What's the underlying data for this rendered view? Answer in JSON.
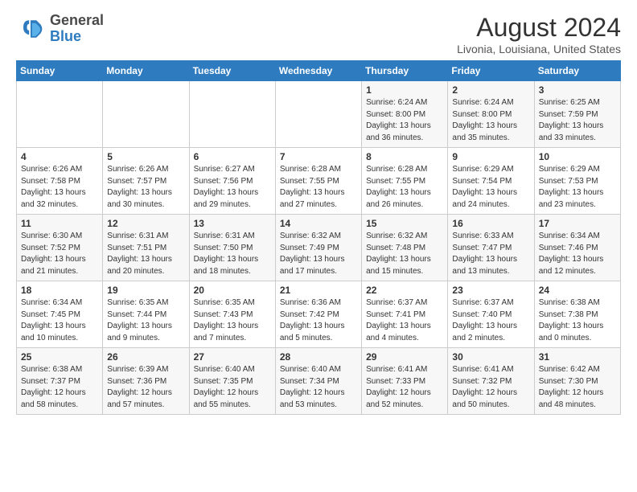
{
  "header": {
    "logo_general": "General",
    "logo_blue": "Blue",
    "month_title": "August 2024",
    "subtitle": "Livonia, Louisiana, United States"
  },
  "weekdays": [
    "Sunday",
    "Monday",
    "Tuesday",
    "Wednesday",
    "Thursday",
    "Friday",
    "Saturday"
  ],
  "weeks": [
    [
      {
        "day": "",
        "content": ""
      },
      {
        "day": "",
        "content": ""
      },
      {
        "day": "",
        "content": ""
      },
      {
        "day": "",
        "content": ""
      },
      {
        "day": "1",
        "content": "Sunrise: 6:24 AM\nSunset: 8:00 PM\nDaylight: 13 hours\nand 36 minutes."
      },
      {
        "day": "2",
        "content": "Sunrise: 6:24 AM\nSunset: 8:00 PM\nDaylight: 13 hours\nand 35 minutes."
      },
      {
        "day": "3",
        "content": "Sunrise: 6:25 AM\nSunset: 7:59 PM\nDaylight: 13 hours\nand 33 minutes."
      }
    ],
    [
      {
        "day": "4",
        "content": "Sunrise: 6:26 AM\nSunset: 7:58 PM\nDaylight: 13 hours\nand 32 minutes."
      },
      {
        "day": "5",
        "content": "Sunrise: 6:26 AM\nSunset: 7:57 PM\nDaylight: 13 hours\nand 30 minutes."
      },
      {
        "day": "6",
        "content": "Sunrise: 6:27 AM\nSunset: 7:56 PM\nDaylight: 13 hours\nand 29 minutes."
      },
      {
        "day": "7",
        "content": "Sunrise: 6:28 AM\nSunset: 7:55 PM\nDaylight: 13 hours\nand 27 minutes."
      },
      {
        "day": "8",
        "content": "Sunrise: 6:28 AM\nSunset: 7:55 PM\nDaylight: 13 hours\nand 26 minutes."
      },
      {
        "day": "9",
        "content": "Sunrise: 6:29 AM\nSunset: 7:54 PM\nDaylight: 13 hours\nand 24 minutes."
      },
      {
        "day": "10",
        "content": "Sunrise: 6:29 AM\nSunset: 7:53 PM\nDaylight: 13 hours\nand 23 minutes."
      }
    ],
    [
      {
        "day": "11",
        "content": "Sunrise: 6:30 AM\nSunset: 7:52 PM\nDaylight: 13 hours\nand 21 minutes."
      },
      {
        "day": "12",
        "content": "Sunrise: 6:31 AM\nSunset: 7:51 PM\nDaylight: 13 hours\nand 20 minutes."
      },
      {
        "day": "13",
        "content": "Sunrise: 6:31 AM\nSunset: 7:50 PM\nDaylight: 13 hours\nand 18 minutes."
      },
      {
        "day": "14",
        "content": "Sunrise: 6:32 AM\nSunset: 7:49 PM\nDaylight: 13 hours\nand 17 minutes."
      },
      {
        "day": "15",
        "content": "Sunrise: 6:32 AM\nSunset: 7:48 PM\nDaylight: 13 hours\nand 15 minutes."
      },
      {
        "day": "16",
        "content": "Sunrise: 6:33 AM\nSunset: 7:47 PM\nDaylight: 13 hours\nand 13 minutes."
      },
      {
        "day": "17",
        "content": "Sunrise: 6:34 AM\nSunset: 7:46 PM\nDaylight: 13 hours\nand 12 minutes."
      }
    ],
    [
      {
        "day": "18",
        "content": "Sunrise: 6:34 AM\nSunset: 7:45 PM\nDaylight: 13 hours\nand 10 minutes."
      },
      {
        "day": "19",
        "content": "Sunrise: 6:35 AM\nSunset: 7:44 PM\nDaylight: 13 hours\nand 9 minutes."
      },
      {
        "day": "20",
        "content": "Sunrise: 6:35 AM\nSunset: 7:43 PM\nDaylight: 13 hours\nand 7 minutes."
      },
      {
        "day": "21",
        "content": "Sunrise: 6:36 AM\nSunset: 7:42 PM\nDaylight: 13 hours\nand 5 minutes."
      },
      {
        "day": "22",
        "content": "Sunrise: 6:37 AM\nSunset: 7:41 PM\nDaylight: 13 hours\nand 4 minutes."
      },
      {
        "day": "23",
        "content": "Sunrise: 6:37 AM\nSunset: 7:40 PM\nDaylight: 13 hours\nand 2 minutes."
      },
      {
        "day": "24",
        "content": "Sunrise: 6:38 AM\nSunset: 7:38 PM\nDaylight: 13 hours\nand 0 minutes."
      }
    ],
    [
      {
        "day": "25",
        "content": "Sunrise: 6:38 AM\nSunset: 7:37 PM\nDaylight: 12 hours\nand 58 minutes."
      },
      {
        "day": "26",
        "content": "Sunrise: 6:39 AM\nSunset: 7:36 PM\nDaylight: 12 hours\nand 57 minutes."
      },
      {
        "day": "27",
        "content": "Sunrise: 6:40 AM\nSunset: 7:35 PM\nDaylight: 12 hours\nand 55 minutes."
      },
      {
        "day": "28",
        "content": "Sunrise: 6:40 AM\nSunset: 7:34 PM\nDaylight: 12 hours\nand 53 minutes."
      },
      {
        "day": "29",
        "content": "Sunrise: 6:41 AM\nSunset: 7:33 PM\nDaylight: 12 hours\nand 52 minutes."
      },
      {
        "day": "30",
        "content": "Sunrise: 6:41 AM\nSunset: 7:32 PM\nDaylight: 12 hours\nand 50 minutes."
      },
      {
        "day": "31",
        "content": "Sunrise: 6:42 AM\nSunset: 7:30 PM\nDaylight: 12 hours\nand 48 minutes."
      }
    ]
  ]
}
